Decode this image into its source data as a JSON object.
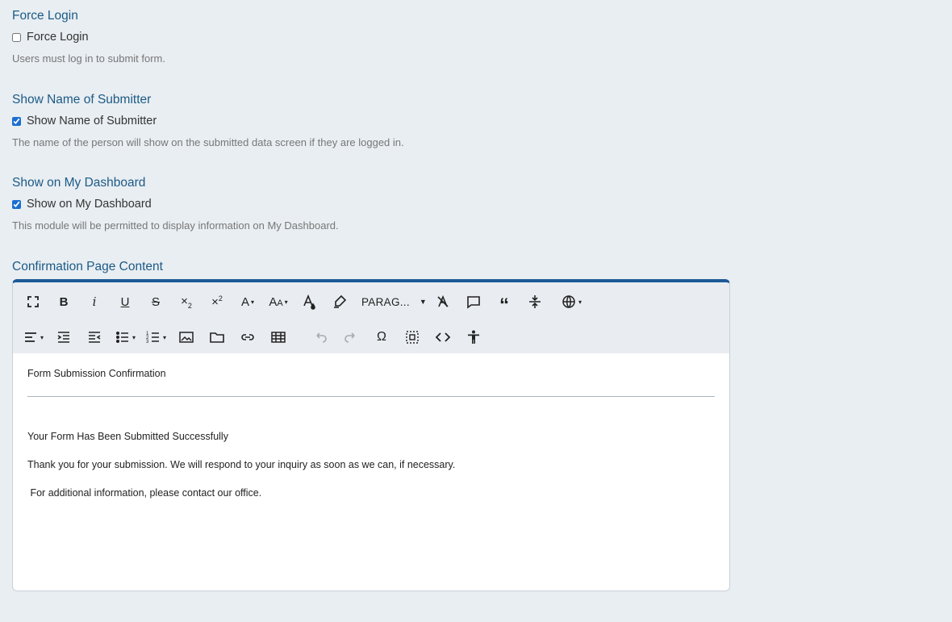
{
  "sections": {
    "force_login": {
      "title": "Force Login",
      "checkbox_label": "Force Login",
      "checked": false,
      "help": "Users must log in to submit form."
    },
    "show_name": {
      "title": "Show Name of Submitter",
      "checkbox_label": "Show Name of Submitter",
      "checked": true,
      "help": "The name of the person will show on the submitted data screen if they are logged in."
    },
    "show_dashboard": {
      "title": "Show on My Dashboard",
      "checkbox_label": "Show on My Dashboard",
      "checked": true,
      "help": "This module will be permitted to display information on My Dashboard."
    },
    "confirmation": {
      "title": "Confirmation Page Content"
    }
  },
  "editor": {
    "toolbar": {
      "paragraph_select": "PARAG...",
      "row1_icons": [
        "fullscreen-icon",
        "bold-icon",
        "italic-icon",
        "underline-icon",
        "strikethrough-icon",
        "subscript-icon",
        "superscript-icon",
        "font-family-icon",
        "font-size-icon",
        "text-color-icon",
        "highlight-icon",
        "paragraph-format",
        "clear-formatting-icon",
        "comment-icon",
        "quote-icon",
        "page-break-icon",
        "language-icon"
      ],
      "row2_icons": [
        "align-icon",
        "indent-icon",
        "outdent-icon",
        "bullet-list-icon",
        "numbered-list-icon",
        "image-icon",
        "folder-icon",
        "link-icon",
        "table-icon",
        "undo-icon",
        "redo-icon",
        "special-char-icon",
        "select-all-icon",
        "code-view-icon",
        "accessibility-icon"
      ]
    },
    "content": {
      "heading": "Form Submission Confirmation",
      "line1": "Your Form Has Been Submitted Successfully",
      "line2": "Thank you for your submission. We will respond to your inquiry as soon as we can, if necessary.",
      "line3": " For additional information, please contact our office."
    }
  }
}
